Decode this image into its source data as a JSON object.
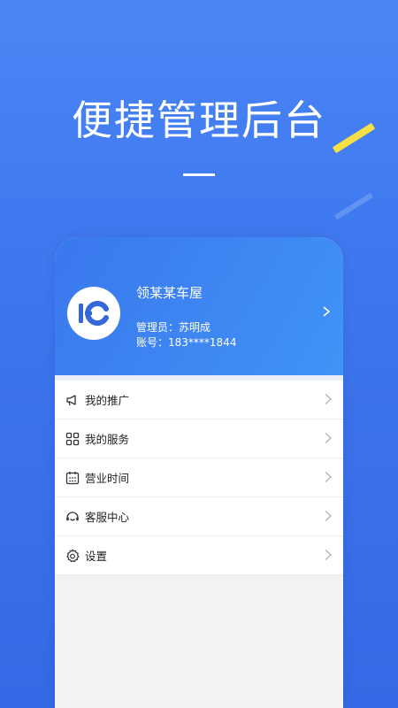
{
  "hero": {
    "title": "便捷管理后台"
  },
  "profile": {
    "shop_name": "领某某车屋",
    "admin_label": "管理员：",
    "admin_name": "苏明成",
    "account_label": "账号：",
    "account_value": "183****1844",
    "avatar_icon": "ic-logo-icon"
  },
  "menu": {
    "items": [
      {
        "label": "我的推广",
        "icon": "megaphone-icon"
      },
      {
        "label": "我的服务",
        "icon": "grid-icon"
      },
      {
        "label": "营业时间",
        "icon": "calendar-icon"
      },
      {
        "label": "客服中心",
        "icon": "headset-icon"
      },
      {
        "label": "设置",
        "icon": "gear-icon"
      }
    ]
  },
  "colors": {
    "background": "#3d76ee",
    "accent": "#f5e046",
    "card_gradient_end": "#3f95f7",
    "text_dark": "#222222"
  }
}
